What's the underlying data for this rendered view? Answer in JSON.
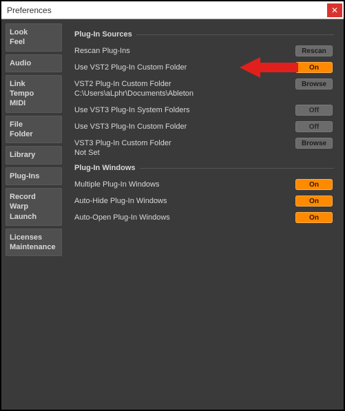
{
  "window": {
    "title": "Preferences"
  },
  "sidebar": {
    "tabs": [
      {
        "id": "look-feel",
        "label": "Look\nFeel"
      },
      {
        "id": "audio",
        "label": "Audio"
      },
      {
        "id": "link-tempo-midi",
        "label": "Link\nTempo\nMIDI"
      },
      {
        "id": "file-folder",
        "label": "File\nFolder"
      },
      {
        "id": "library",
        "label": "Library"
      },
      {
        "id": "plug-ins",
        "label": "Plug-Ins"
      },
      {
        "id": "record-warp-launch",
        "label": "Record\nWarp\nLaunch"
      },
      {
        "id": "licenses-maintenance",
        "label": "Licenses\nMaintenance"
      }
    ]
  },
  "sections": {
    "sources": "Plug-In Sources",
    "windows": "Plug-In Windows"
  },
  "rows": {
    "rescan": {
      "label": "Rescan Plug-Ins",
      "btn": "Rescan"
    },
    "use_vst2_custom": {
      "label": "Use VST2 Plug-In Custom Folder",
      "btn": "On"
    },
    "vst2_folder": {
      "label": "VST2 Plug-In Custom Folder",
      "btn": "Browse",
      "path": "C:\\Users\\aLphr\\Documents\\Ableton"
    },
    "use_vst3_system": {
      "label": "Use VST3 Plug-In System Folders",
      "btn": "Off"
    },
    "use_vst3_custom": {
      "label": "Use VST3 Plug-In Custom Folder",
      "btn": "Off"
    },
    "vst3_folder": {
      "label": "VST3 Plug-In Custom Folder",
      "btn": "Browse",
      "path": "Not Set"
    },
    "multi_windows": {
      "label": "Multiple Plug-In Windows",
      "btn": "On"
    },
    "auto_hide": {
      "label": "Auto-Hide Plug-In Windows",
      "btn": "On"
    },
    "auto_open": {
      "label": "Auto-Open Plug-In Windows",
      "btn": "On"
    }
  },
  "colors": {
    "accent": "#ff8a00"
  }
}
